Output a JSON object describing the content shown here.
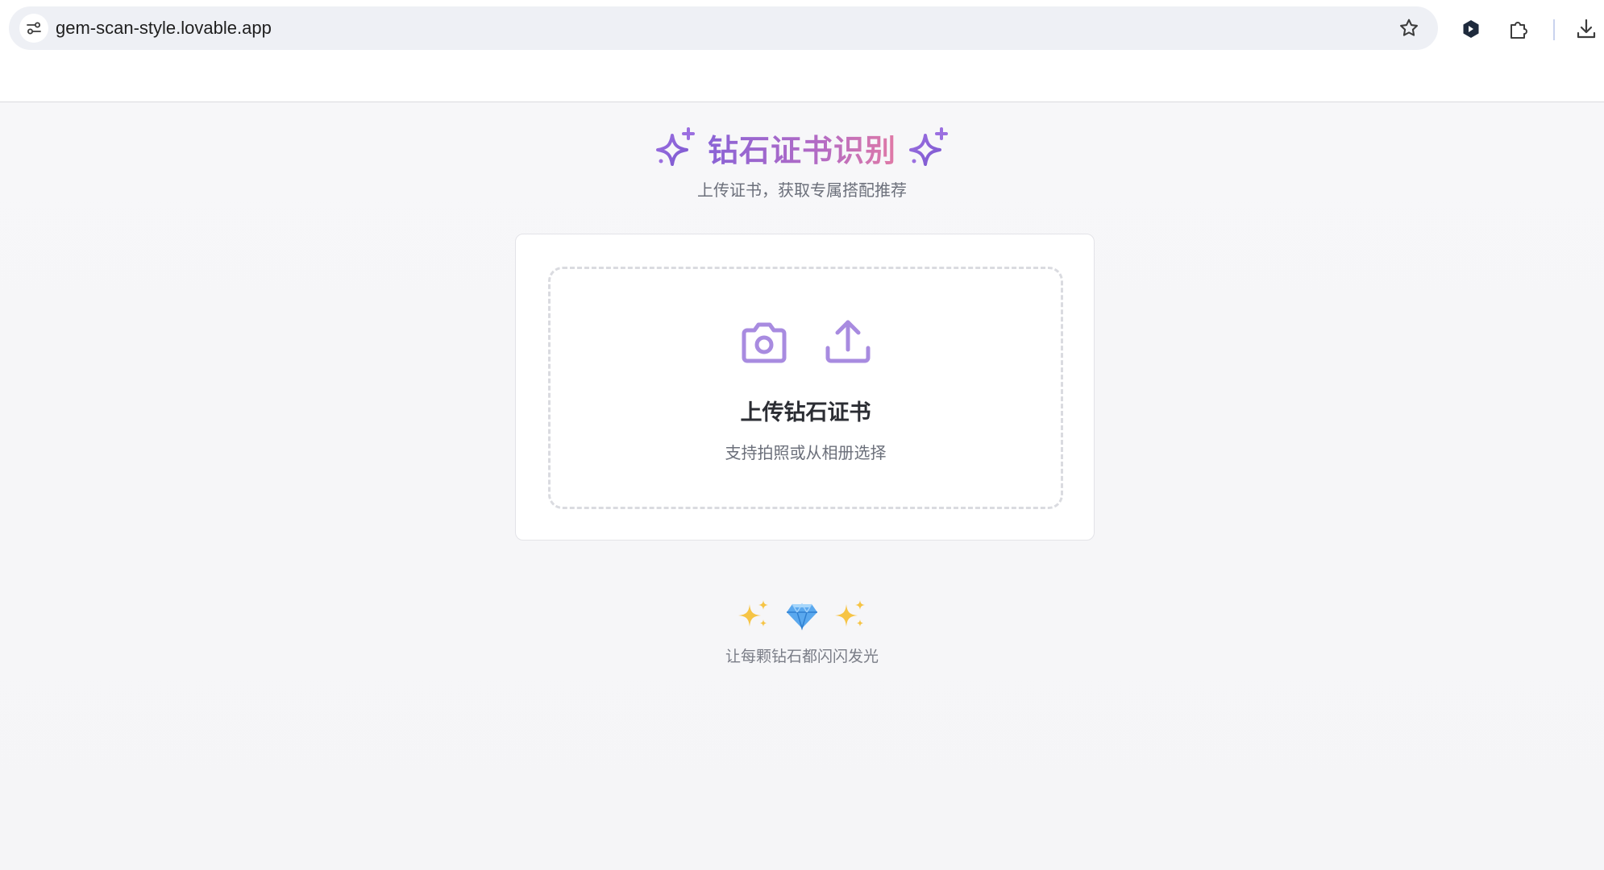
{
  "browser": {
    "url": "gem-scan-style.lovable.app"
  },
  "page": {
    "title": "钻石证书识别",
    "subtitle": "上传证书，获取专属搭配推荐",
    "accent_colors": [
      "#8a63d6",
      "#e07aa6"
    ]
  },
  "upload": {
    "title": "上传钻石证书",
    "subtitle": "支持拍照或从相册选择",
    "icons": [
      "camera-icon",
      "upload-icon"
    ],
    "icon_color": "#a88be0"
  },
  "footer": {
    "emojis": [
      "sparkles-icon",
      "gem-icon",
      "sparkles-icon"
    ],
    "tagline": "让每颗钻石都闪闪发光"
  }
}
